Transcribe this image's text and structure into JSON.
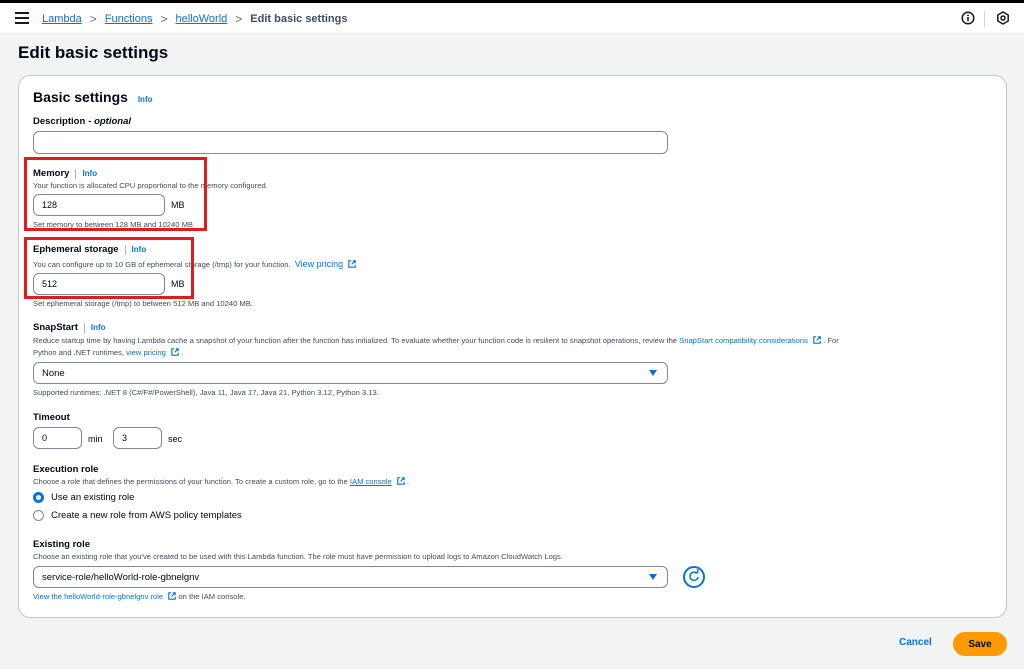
{
  "breadcrumb": {
    "items": [
      "Lambda",
      "Functions",
      "helloWorld"
    ],
    "current": "Edit basic settings",
    "separator": ">"
  },
  "page": {
    "title": "Edit basic settings"
  },
  "panel": {
    "title": "Basic settings",
    "info_label": "Info"
  },
  "description_field": {
    "label": "Description",
    "label_suffix": "- optional",
    "value": ""
  },
  "memory": {
    "label": "Memory",
    "info": "Info",
    "description": "Your function is allocated CPU proportional to the memory configured.",
    "value": "128",
    "unit": "MB",
    "hint": "Set memory to between 128 MB and 10240 MB"
  },
  "ephemeral": {
    "label": "Ephemeral storage",
    "info": "Info",
    "description": "You can configure up to 10 GB of ephemeral storage (/tmp) for your function.",
    "link": "View pricing",
    "value": "512",
    "unit": "MB",
    "hint": "Set ephemeral storage (/tmp) to between 512 MB and 10240 MB."
  },
  "snapstart": {
    "label": "SnapStart",
    "info": "Info",
    "desc_line1": "Reduce startup time by having Lambda cache a snapshot of your function after the function has initialized. To evaluate whether your function code is resilient to snapshot operations, review the",
    "desc_link1": "SnapStart compatibility considerations",
    "desc_line1_end": ". For",
    "desc_line2": "Python and .NET runtimes,",
    "desc_link2": "view pricing",
    "desc_line2_end": ".",
    "selected": "None",
    "hint": "Supported runtimes: .NET 8 (C#/F#/PowerShell), Java 11, Java 17, Java 21, Python 3.12, Python 3.13."
  },
  "timeout": {
    "label": "Timeout",
    "min_value": "0",
    "min_unit": "min",
    "sec_value": "3",
    "sec_unit": "sec"
  },
  "execution_role": {
    "label": "Execution role",
    "description": "Choose a role that defines the permissions of your function. To create a custom role, go to the",
    "link": "IAM console",
    "description_end": ".",
    "options": [
      "Use an existing role",
      "Create a new role from AWS policy templates"
    ],
    "selected_index": 0
  },
  "existing_role": {
    "label": "Existing role",
    "description": "Choose an existing role that you've created to be used with this Lambda function. The role must have permission to upload logs to Amazon CloudWatch Logs.",
    "selected": "service-role/helloWorld-role-gbnelgnv",
    "link": "View the helloWorld-role-gbnelgnv role",
    "link_suffix": "on the IAM console."
  },
  "actions": {
    "cancel": "Cancel",
    "save": "Save"
  },
  "colors": {
    "accent": "#0972d3",
    "primary_button": "#ff9900",
    "highlight": "#e11b22"
  }
}
